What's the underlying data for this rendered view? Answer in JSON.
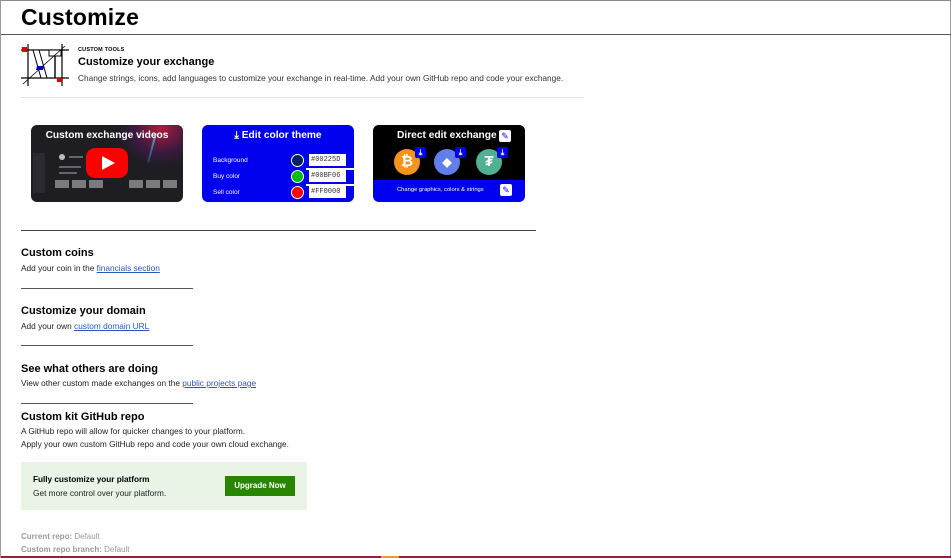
{
  "page": {
    "title": "Customize"
  },
  "tools": {
    "kicker": "CUSTOM TOOLS",
    "title": "Customize your exchange",
    "description": "Change strings, icons, add languages to customize your exchange in real-time. Add your own GitHub repo and code your exchange."
  },
  "cards": {
    "video": {
      "title": "Custom exchange videos"
    },
    "color_theme": {
      "title": "Edit color theme",
      "rows": [
        {
          "label": "Background",
          "value": "#00225D",
          "color": "#00225D"
        },
        {
          "label": "Buy color",
          "value": "#00BF06",
          "color": "#00BF06"
        },
        {
          "label": "Sell color",
          "value": "#FF0000",
          "color": "#FF0000"
        }
      ]
    },
    "direct_edit": {
      "title": "Direct edit exchange",
      "caption": "Change graphics, colors & strings",
      "coins": [
        {
          "icon": "bitcoin-icon",
          "glyph": "₿",
          "color": "#f7931a"
        },
        {
          "icon": "ethereum-icon",
          "glyph": "◆",
          "color": "#627eea"
        },
        {
          "icon": "tether-icon",
          "glyph": "₮",
          "color": "#50af95"
        }
      ]
    }
  },
  "sections": {
    "coins": {
      "title": "Custom coins",
      "text": "Add your coin in the ",
      "link": "financials section"
    },
    "domain": {
      "title": "Customize your domain",
      "text": "Add your own ",
      "link": "custom domain URL"
    },
    "others": {
      "title": "See what others are doing",
      "text": "View other custom made exchanges on the ",
      "link": "public projects page"
    },
    "github": {
      "title": "Custom kit GitHub repo",
      "line1": "A GitHub repo will allow for quicker changes to your platform.",
      "line2": "Apply your own custom GitHub repo and code your own cloud exchange."
    }
  },
  "upgrade": {
    "title": "Fully customize your platform",
    "text": "Get more control over your platform.",
    "button": "Upgrade Now"
  },
  "repo": {
    "current_label": "Current repo:",
    "current_value": "Default",
    "branch_label": "Custom repo branch:",
    "branch_value": "Default"
  },
  "colors": {
    "accent_blue": "#0000ee",
    "upgrade_green": "#288500",
    "link_blue": "#2a55c4"
  }
}
